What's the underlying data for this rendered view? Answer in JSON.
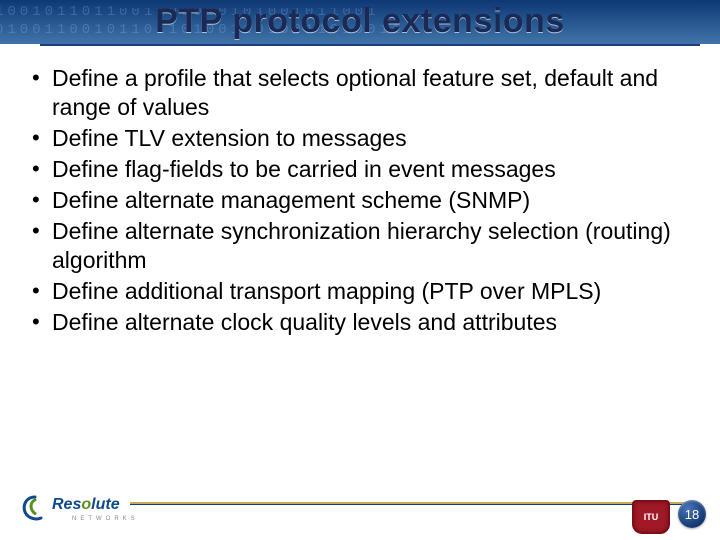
{
  "title": "PTP protocol extensions",
  "bullets": [
    "Define a profile that selects optional feature set, default and range of values",
    "Define TLV extension to messages",
    "Define flag-fields to be carried in event messages",
    "Define alternate management scheme (SNMP)",
    "Define alternate synchronization hierarchy selection (routing) algorithm",
    "Define additional transport mapping (PTP over MPLS)",
    "Define alternate clock quality levels and attributes"
  ],
  "footer": {
    "logo_main": "Res",
    "logo_accent": "o",
    "logo_rest": "lute",
    "logo_sub": "NETWORKS",
    "itu_label": "ITU",
    "page_number": "18"
  }
}
